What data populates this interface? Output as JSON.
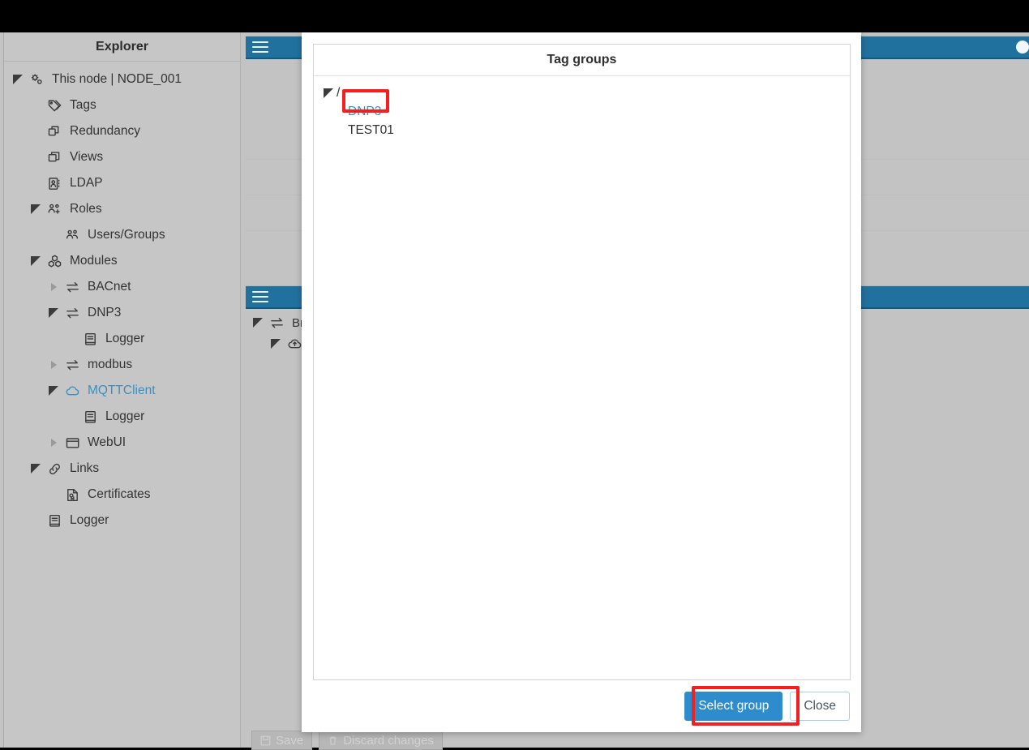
{
  "window": {
    "titlebar_color": "#000000"
  },
  "explorer": {
    "title": "Explorer",
    "items": [
      {
        "label": "This node | NODE_001",
        "icon": "gears-icon",
        "indent": 0,
        "twisty": "open",
        "accent": false
      },
      {
        "label": "Tags",
        "icon": "tag-icon",
        "indent": 1,
        "twisty": "none",
        "accent": false
      },
      {
        "label": "Redundancy",
        "icon": "copy-icon",
        "indent": 1,
        "twisty": "none",
        "accent": false
      },
      {
        "label": "Views",
        "icon": "windows-icon",
        "indent": 1,
        "twisty": "none",
        "accent": false
      },
      {
        "label": "LDAP",
        "icon": "contact-icon",
        "indent": 1,
        "twisty": "none",
        "accent": false
      },
      {
        "label": "Roles",
        "icon": "users-add-icon",
        "indent": 1,
        "twisty": "open",
        "accent": false
      },
      {
        "label": "Users/Groups",
        "icon": "users-icon",
        "indent": 2,
        "twisty": "none",
        "accent": false
      },
      {
        "label": "Modules",
        "icon": "modules-icon",
        "indent": 1,
        "twisty": "open",
        "accent": false
      },
      {
        "label": "BACnet",
        "icon": "transfer-icon",
        "indent": 2,
        "twisty": "closed",
        "accent": false
      },
      {
        "label": "DNP3",
        "icon": "transfer-icon",
        "indent": 2,
        "twisty": "open",
        "accent": false
      },
      {
        "label": "Logger",
        "icon": "logger-icon",
        "indent": 3,
        "twisty": "none",
        "accent": false
      },
      {
        "label": "modbus",
        "icon": "transfer-icon",
        "indent": 2,
        "twisty": "closed",
        "accent": false
      },
      {
        "label": "MQTTClient",
        "icon": "cloud-icon",
        "indent": 2,
        "twisty": "open",
        "accent": true
      },
      {
        "label": "Logger",
        "icon": "logger-icon",
        "indent": 3,
        "twisty": "none",
        "accent": false
      },
      {
        "label": "WebUI",
        "icon": "window-icon",
        "indent": 2,
        "twisty": "closed",
        "accent": false
      },
      {
        "label": "Links",
        "icon": "link-icon",
        "indent": 1,
        "twisty": "open",
        "accent": false
      },
      {
        "label": "Certificates",
        "icon": "cert-icon",
        "indent": 2,
        "twisty": "none",
        "accent": false
      },
      {
        "label": "Logger",
        "icon": "logger-icon",
        "indent": 1,
        "twisty": "none",
        "accent": false
      }
    ]
  },
  "background_panes": {
    "accent_color": "#21719f",
    "top_pane": {
      "menu_icon": "hamburger-icon",
      "status_icon": "circle-icon"
    },
    "bottom_pane": {
      "menu_icon": "hamburger-icon",
      "items": [
        {
          "label": "Br",
          "icon": "transfer-icon",
          "twisty": "open",
          "indent": 0
        },
        {
          "label": "",
          "icon": "cloud-upload-icon",
          "twisty": "open",
          "indent": 1
        },
        {
          "label": "",
          "icon": "tag-icon",
          "twisty": "none",
          "indent": 2
        }
      ]
    }
  },
  "bottom_toolbar": {
    "save_label": "Save",
    "save_icon": "save-icon",
    "discard_label": "Discard changes",
    "discard_icon": "trash-icon"
  },
  "modal": {
    "title": "Tag groups",
    "tree": {
      "root": {
        "label": "/",
        "twisty": "open"
      },
      "children": [
        {
          "label": "DNP3",
          "selected": true
        },
        {
          "label": "TEST01",
          "selected": false
        }
      ]
    },
    "buttons": {
      "primary_label": "Select group",
      "secondary_label": "Close"
    },
    "colors": {
      "primary_button": "#2e8ccd",
      "selected_text": "#3b8fc4",
      "annotation": "#f61f1f"
    }
  }
}
